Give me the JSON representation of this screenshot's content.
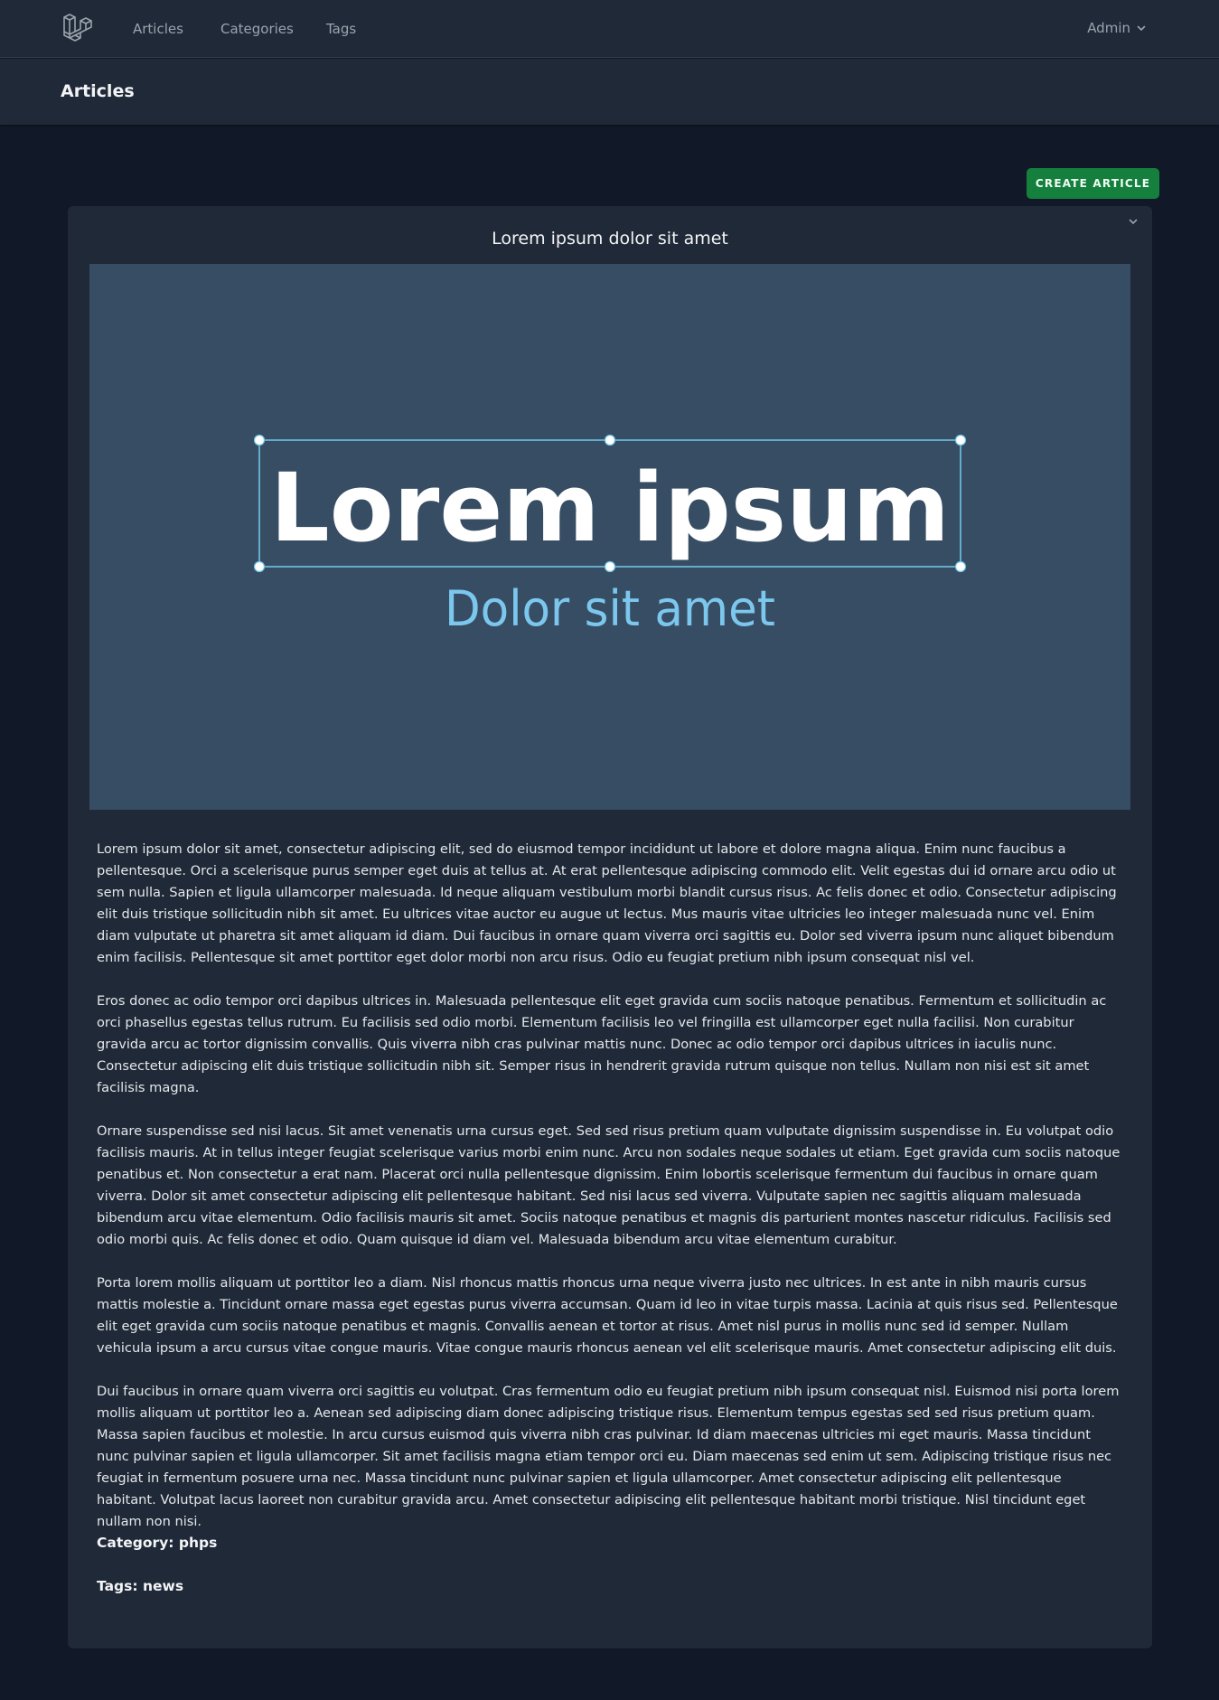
{
  "nav": {
    "links": [
      "Articles",
      "Categories",
      "Tags"
    ],
    "user": "Admin",
    "logo_icon": "laravel-logo-icon"
  },
  "header": {
    "title": "Articles"
  },
  "actions": {
    "create_label": "CREATE ARTICLE"
  },
  "article": {
    "title": "Lorem ipsum dolor sit amet",
    "image": {
      "headline": "Lorem ipsum",
      "subline": "Dolor sit amet"
    },
    "paragraphs": [
      "Lorem ipsum dolor sit amet, consectetur adipiscing elit, sed do eiusmod tempor incididunt ut labore et dolore magna aliqua. Enim nunc faucibus a pellentesque. Orci a scelerisque purus semper eget duis at tellus at. At erat pellentesque adipiscing commodo elit. Velit egestas dui id ornare arcu odio ut sem nulla. Sapien et ligula ullamcorper malesuada. Id neque aliquam vestibulum morbi blandit cursus risus. Ac felis donec et odio. Consectetur adipiscing elit duis tristique sollicitudin nibh sit amet. Eu ultrices vitae auctor eu augue ut lectus. Mus mauris vitae ultricies leo integer malesuada nunc vel. Enim diam vulputate ut pharetra sit amet aliquam id diam. Dui faucibus in ornare quam viverra orci sagittis eu. Dolor sed viverra ipsum nunc aliquet bibendum enim facilisis. Pellentesque sit amet porttitor eget dolor morbi non arcu risus. Odio eu feugiat pretium nibh ipsum consequat nisl vel.",
      "Eros donec ac odio tempor orci dapibus ultrices in. Malesuada pellentesque elit eget gravida cum sociis natoque penatibus. Fermentum et sollicitudin ac orci phasellus egestas tellus rutrum. Eu facilisis sed odio morbi. Elementum facilisis leo vel fringilla est ullamcorper eget nulla facilisi. Non curabitur gravida arcu ac tortor dignissim convallis. Quis viverra nibh cras pulvinar mattis nunc. Donec ac odio tempor orci dapibus ultrices in iaculis nunc. Consectetur adipiscing elit duis tristique sollicitudin nibh sit. Semper risus in hendrerit gravida rutrum quisque non tellus. Nullam non nisi est sit amet facilisis magna.",
      "Ornare suspendisse sed nisi lacus. Sit amet venenatis urna cursus eget. Sed sed risus pretium quam vulputate dignissim suspendisse in. Eu volutpat odio facilisis mauris. At in tellus integer feugiat scelerisque varius morbi enim nunc. Arcu non sodales neque sodales ut etiam. Eget gravida cum sociis natoque penatibus et. Non consectetur a erat nam. Placerat orci nulla pellentesque dignissim. Enim lobortis scelerisque fermentum dui faucibus in ornare quam viverra. Dolor sit amet consectetur adipiscing elit pellentesque habitant. Sed nisi lacus sed viverra. Vulputate sapien nec sagittis aliquam malesuada bibendum arcu vitae elementum. Odio facilisis mauris sit amet. Sociis natoque penatibus et magnis dis parturient montes nascetur ridiculus. Facilisis sed odio morbi quis. Ac felis donec et odio. Quam quisque id diam vel. Malesuada bibendum arcu vitae elementum curabitur.",
      "Porta lorem mollis aliquam ut porttitor leo a diam. Nisl rhoncus mattis rhoncus urna neque viverra justo nec ultrices. In est ante in nibh mauris cursus mattis molestie a. Tincidunt ornare massa eget egestas purus viverra accumsan. Quam id leo in vitae turpis massa. Lacinia at quis risus sed. Pellentesque elit eget gravida cum sociis natoque penatibus et magnis. Convallis aenean et tortor at risus. Amet nisl purus in mollis nunc sed id semper. Nullam vehicula ipsum a arcu cursus vitae congue mauris. Vitae congue mauris rhoncus aenean vel elit scelerisque mauris. Amet consectetur adipiscing elit duis.",
      "Dui faucibus in ornare quam viverra orci sagittis eu volutpat. Cras fermentum odio eu feugiat pretium nibh ipsum consequat nisl. Euismod nisi porta lorem mollis aliquam ut porttitor leo a. Aenean sed adipiscing diam donec adipiscing tristique risus. Elementum tempus egestas sed sed risus pretium quam. Massa sapien faucibus et molestie. In arcu cursus euismod quis viverra nibh cras pulvinar. Id diam maecenas ultricies mi eget mauris. Massa tincidunt nunc pulvinar sapien et ligula ullamcorper. Sit amet facilisis magna etiam tempor orci eu. Diam maecenas sed enim ut sem. Adipiscing tristique risus nec feugiat in fermentum posuere urna nec. Massa tincidunt nunc pulvinar sapien et ligula ullamcorper. Amet consectetur adipiscing elit pellentesque habitant. Volutpat lacus laoreet non curabitur gravida arcu. Amet consectetur adipiscing elit pellentesque habitant morbi tristique. Nisl tincidunt eget nullam non nisi."
    ],
    "category_line": "Category: phps",
    "tags_line": "Tags: news"
  },
  "colors": {
    "background": "#111827",
    "surface": "#1f2937",
    "accent_button": "#15803d",
    "image_background": "#374d63",
    "subline": "#7cc7ee",
    "selection": "#6ec4e6"
  }
}
